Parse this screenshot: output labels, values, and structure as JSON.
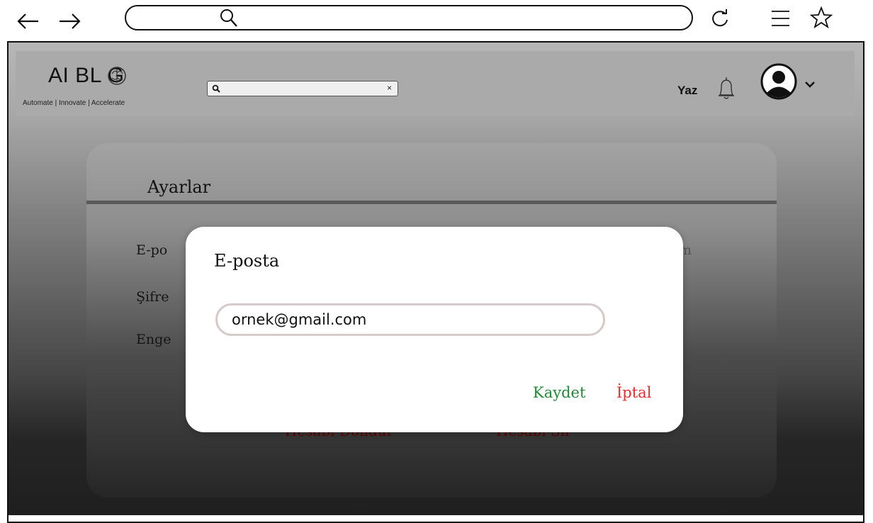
{
  "browser": {
    "back_icon": "arrow-left-icon",
    "forward_icon": "arrow-right-icon",
    "search_icon": "search-icon",
    "reload_icon": "reload-icon",
    "menu_icon": "menu-icon",
    "bookmark_icon": "star-icon"
  },
  "header": {
    "logo": "AI BL   G",
    "tagline": "Automate | Innovate | Accelerate",
    "search_close": "×",
    "write_label": "Yaz",
    "bell_icon": "bell-icon",
    "avatar_icon": "user-avatar-icon",
    "chevron_icon": "chevron-down-icon"
  },
  "settings": {
    "title": "Ayarlar",
    "rows": [
      "E-po",
      "Şifre",
      "Enge"
    ],
    "row_right_fragment": "m",
    "freeze_account": "Hesabı Dondur",
    "delete_account": "Hesabı Sil"
  },
  "modal": {
    "title": "E-posta",
    "email_value": "ornek@gmail.com",
    "save_label": "Kaydet",
    "cancel_label": "İptal"
  },
  "colors": {
    "save": "#1e8a33",
    "cancel": "#ef2b2b",
    "danger": "#5c0000"
  }
}
